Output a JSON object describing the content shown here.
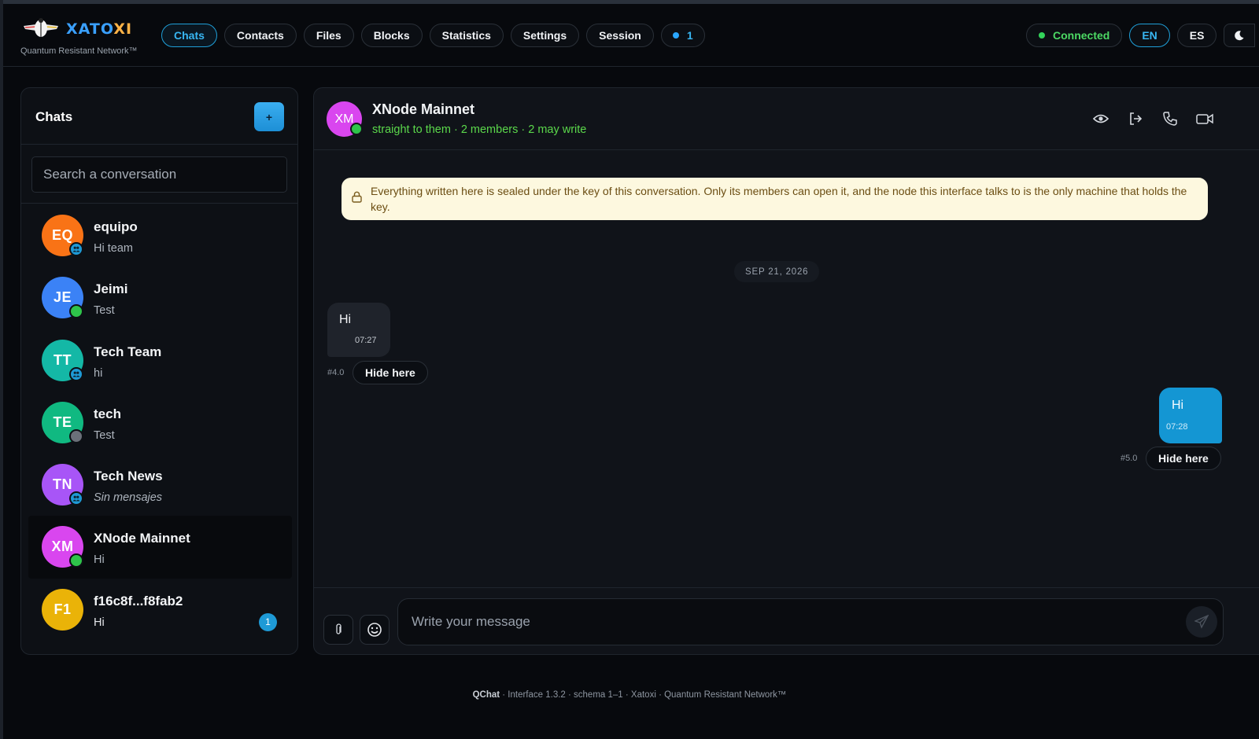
{
  "brand": {
    "name_part1": "XATO",
    "name_part2": "XI",
    "tagline": "Quantum Resistant Network™"
  },
  "nav": {
    "tabs": [
      {
        "label": "Chats",
        "active": true
      },
      {
        "label": "Contacts",
        "active": false
      },
      {
        "label": "Files",
        "active": false
      },
      {
        "label": "Blocks",
        "active": false
      },
      {
        "label": "Statistics",
        "active": false
      },
      {
        "label": "Settings",
        "active": false
      },
      {
        "label": "Session",
        "active": false
      }
    ],
    "notification_count": "1"
  },
  "status": {
    "connection": "Connected",
    "lang_en": "EN",
    "lang_es": "ES",
    "theme_icon": "moon-icon"
  },
  "sidebar": {
    "title": "Chats",
    "new_button": "+",
    "search_placeholder": "Search a conversation",
    "chats": [
      {
        "initials": "EQ",
        "name": "equipo",
        "preview": "Hi team",
        "color": "#f97316",
        "status": "group"
      },
      {
        "initials": "JE",
        "name": "Jeimi",
        "preview": "Test",
        "color": "#3b82f6",
        "status": "online"
      },
      {
        "initials": "TT",
        "name": "Tech Team",
        "preview": "hi",
        "color": "#14b8a6",
        "status": "group"
      },
      {
        "initials": "TE",
        "name": "tech",
        "preview": "Test",
        "color": "#10b981",
        "status": "offline"
      },
      {
        "initials": "TN",
        "name": "Tech News",
        "preview": "Sin mensajes",
        "color": "#a855f7",
        "status": "group"
      },
      {
        "initials": "XM",
        "name": "XNode Mainnet",
        "preview": "Hi",
        "color": "#d946ef",
        "status": "online"
      },
      {
        "initials": "F1",
        "name": "f16c8f...f8fab2",
        "preview": "Hi",
        "color": "#eab308",
        "status": "none",
        "unread": "1"
      }
    ]
  },
  "conversation": {
    "initials": "XM",
    "title": "XNode Mainnet",
    "subtitle": "straight to them · 2 members · 2 may write",
    "notice": "Everything written here is sealed under the key of this conversation. Only its members can open it, and the node this interface talks to is the only machine that holds the key.",
    "date": "SEP 21, 2026",
    "messages": [
      {
        "text": "Hi",
        "time": "07:27",
        "id": "#4.0",
        "hide_label": "Hide here"
      },
      {
        "text": "Hi",
        "time": "07:28",
        "id": "#5.0",
        "hide_label": "Hide here"
      }
    ],
    "composer_placeholder": "Write your message"
  },
  "footer": {
    "app": "QChat",
    "rest": " · Interface 1.3.2 · schema 1–1 · Xatoxi · Quantum Resistant Network™"
  },
  "colors": {
    "accent": "#1f9fd8",
    "online": "#2ec44a",
    "outgoing_bubble": "#1496d3"
  }
}
